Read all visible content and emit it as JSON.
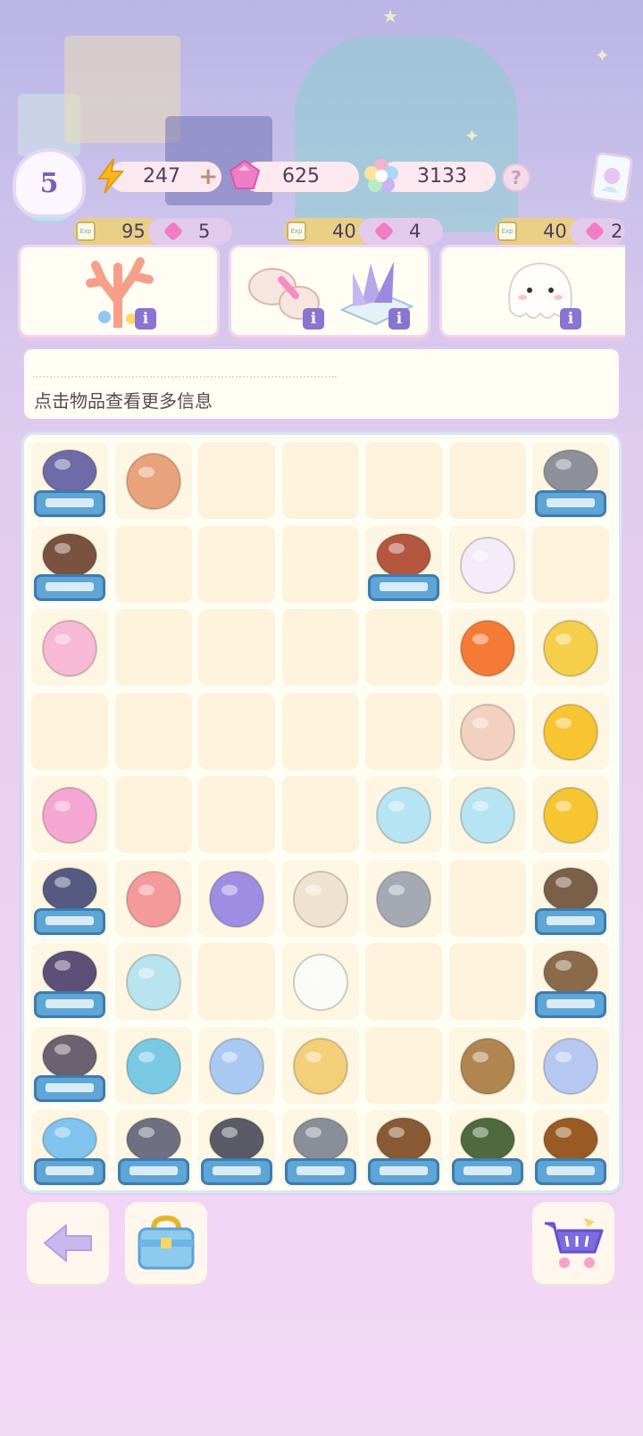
{
  "top_bar": {
    "level": "5",
    "energy": "247",
    "energy_add": "+",
    "gems": "625",
    "stars": "3133",
    "help": "?"
  },
  "orders": [
    {
      "exp": "95",
      "gems": "5",
      "items": [
        "coral-icon"
      ]
    },
    {
      "exp": "40",
      "gems": "4",
      "items": [
        "yarn-bundle-icon",
        "feather-bundle-icon"
      ]
    },
    {
      "exp": "40",
      "gems": "2",
      "items": [
        "ghost-plush-icon"
      ]
    }
  ],
  "exp_badge": "Exp",
  "info_i": "i",
  "info_box": {
    "hint": "点击物品查看更多信息"
  },
  "grid": {
    "rows": [
      [
        "striped-cone-crate",
        "clay-bricks",
        "",
        "",
        "",
        "",
        "gray-sack-crate"
      ],
      [
        "wood-plank-crate",
        "",
        "",
        "",
        "red-fish-crate",
        "unicorn-cat",
        ""
      ],
      [
        "pink-hamster-bed",
        "",
        "",
        "",
        "",
        "goldfish",
        "gold-gift-box"
      ],
      [
        "",
        "",
        "",
        "",
        "",
        "hamster-hat",
        "lightning-stack"
      ],
      [
        "yarn-balls",
        "",
        "",
        "",
        "hamster-diaper",
        "hamster-diaper",
        "lightning"
      ],
      [
        "dark-cone-crate",
        "coral",
        "flower-vase",
        "siamese-cat",
        "gray-fish",
        "",
        "mirror-crate"
      ],
      [
        "machine-crate",
        "thread-spool",
        "",
        "ghost-plush",
        "",
        "",
        "scissors-crate"
      ],
      [
        "satellite-crate",
        "magnifier",
        "cat-bed-blue",
        "feather-bundle",
        "",
        "basket",
        "blue-cushion"
      ],
      [
        "ice-cube-crate",
        "yarn-pile-crate",
        "dumbbell-crate",
        "pliers-crate",
        "brushes-crate",
        "bag-crate",
        "beetle-crate"
      ]
    ]
  },
  "buttons": {
    "back": "back-arrow-icon",
    "toolbox": "toolbox-icon",
    "shop": "shopping-cart-icon"
  },
  "colors": {
    "energy": "#f7b91f",
    "gem": "#f07cc6",
    "accent": "#8a74d0"
  }
}
